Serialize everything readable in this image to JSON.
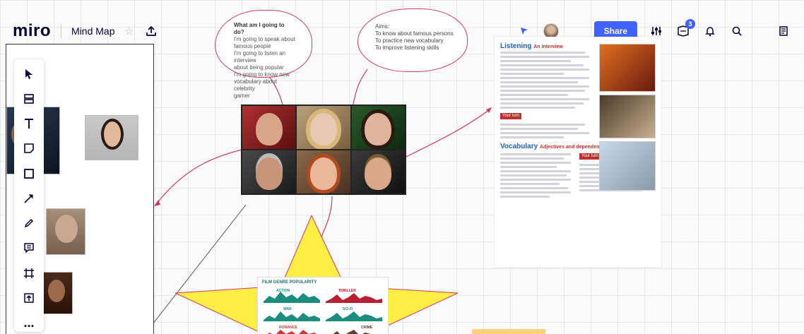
{
  "app": {
    "logo": "miro",
    "board_title": "Mind Map",
    "star_icon": "star-icon",
    "export_icon": "upload-icon"
  },
  "header_right": {
    "share_label": "Share",
    "notification_count": "3",
    "icons": [
      "cursor-icon",
      "avatar",
      "settings-sliders-icon",
      "activity-icon",
      "bell-icon",
      "search-icon",
      "notes-icon"
    ]
  },
  "toolbar": {
    "tools": [
      "select-icon",
      "templates-icon",
      "text-icon",
      "sticky-note-icon",
      "shape-icon",
      "arrow-icon",
      "pen-icon",
      "comment-icon",
      "frame-icon",
      "upload-icon",
      "more-icon"
    ],
    "more_label": "..."
  },
  "cloud_left": {
    "title": "What am I going to do?",
    "lines": [
      "I'm going to  speak about",
      "famous people",
      "I'm going to listen an interview",
      "about being popular",
      "I'm going to know new",
      "vocabulary about celebrity",
      "gamer"
    ]
  },
  "cloud_right": {
    "title": "Aims:",
    "lines": [
      "To know about  famous persons",
      "To practice new vocabulary",
      "To improve listening skills"
    ]
  },
  "document": {
    "section1_title": "Listening",
    "section1_sub": "An interview",
    "your_turn": "Your turn",
    "section2_title": "Vocabulary",
    "section2_sub": "Adjectives and dependent prepositions",
    "your_turn2": "Your turn"
  },
  "chart_card": {
    "title": "FILM GENRE POPULARITY",
    "labels": [
      "ACTION",
      "THRILLER",
      "WAR",
      "SCI-FI",
      "ROMANCE",
      "CRIME"
    ]
  },
  "colors": {
    "accent": "#4262ff",
    "connector": "#c83a6a",
    "star_fill": "#ffee44"
  }
}
